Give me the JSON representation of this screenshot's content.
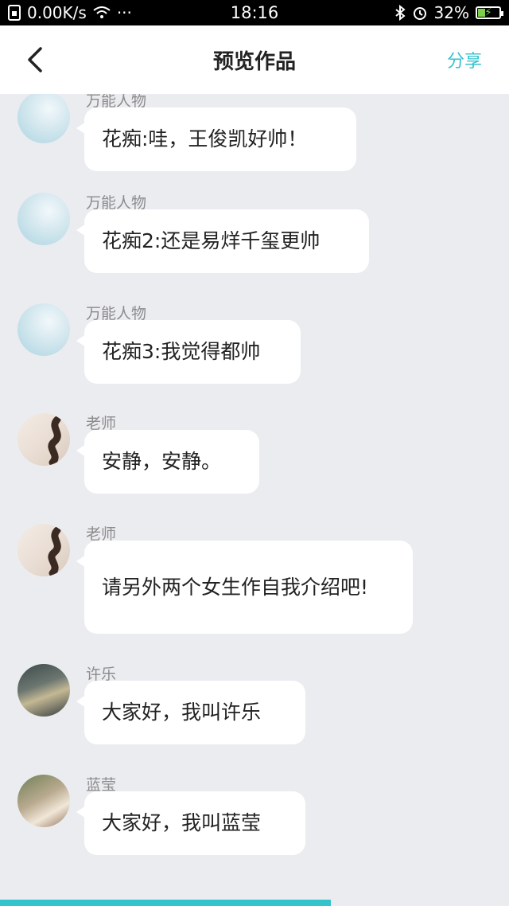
{
  "status_bar": {
    "network_speed": "0.00K/s",
    "dots": "···",
    "time": "18:16",
    "battery": "32%",
    "battery_level": 0.32
  },
  "header": {
    "title": "预览作品",
    "share_label": "分享"
  },
  "messages": [
    {
      "name": "万能人物",
      "text": "花痴:哇，王俊凯好帅！",
      "avatar": "sky"
    },
    {
      "name": "万能人物",
      "text": "花痴2:还是易烊千玺更帅",
      "avatar": "sky"
    },
    {
      "name": "万能人物",
      "text": "花痴3:我觉得都帅",
      "avatar": "sky"
    },
    {
      "name": "老师",
      "text": "安静，安静。",
      "avatar": "teacher"
    },
    {
      "name": "老师",
      "text": "请另外两个女生作自我介绍吧!",
      "avatar": "teacher"
    },
    {
      "name": "许乐",
      "text": "大家好，我叫许乐",
      "avatar": "xule"
    },
    {
      "name": "蓝莹",
      "text": "大家好，我叫蓝莹",
      "avatar": "lanying"
    }
  ],
  "progress": {
    "fraction": 0.65
  },
  "colors": {
    "accent": "#39c2cc",
    "background": "#ebecf0",
    "bubble": "#ffffff"
  }
}
